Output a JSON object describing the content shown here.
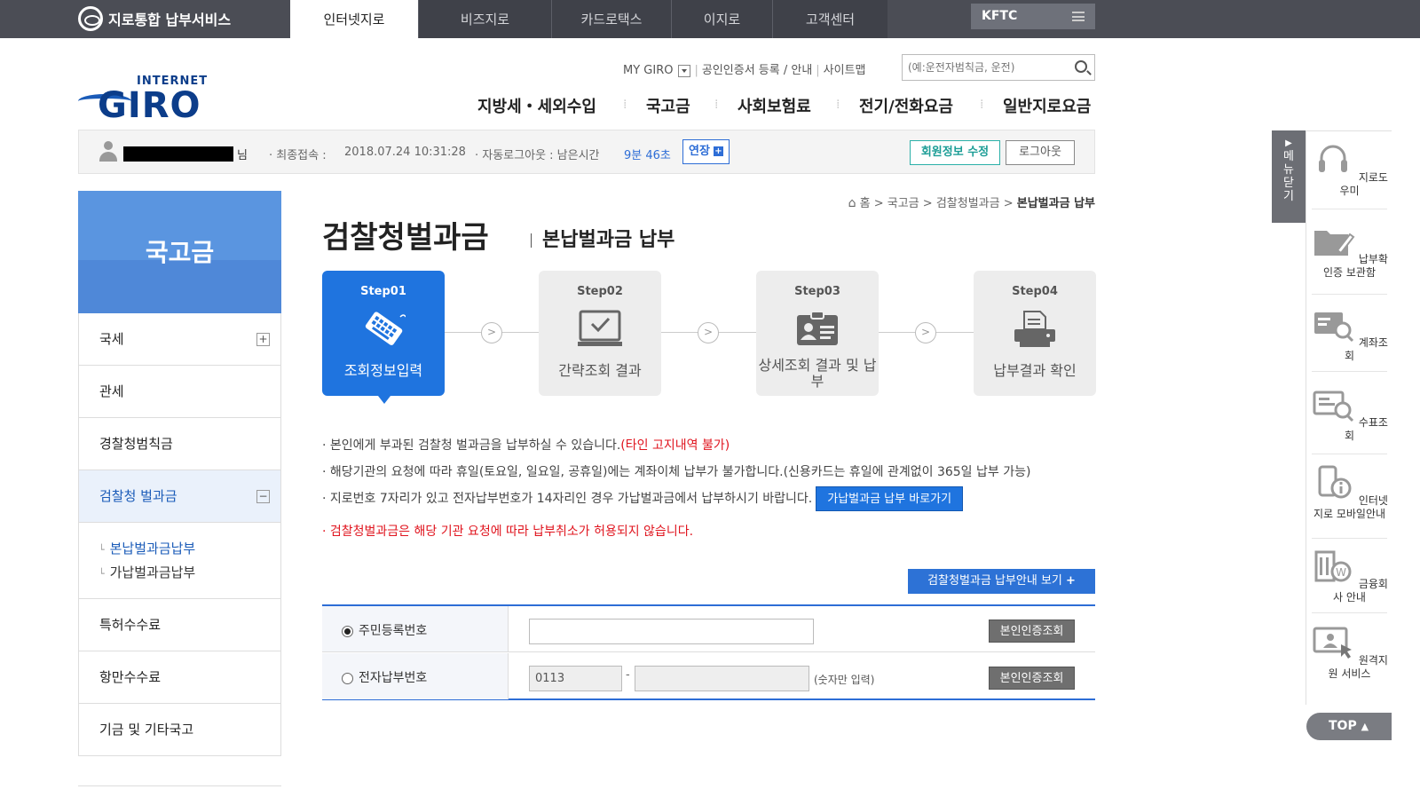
{
  "header": {
    "service_name": "지로통합 납부서비스",
    "tabs": [
      {
        "label": "인터넷지로",
        "active": true
      },
      {
        "label": "비즈지로"
      },
      {
        "label": "카드로택스"
      },
      {
        "label": "이지로"
      },
      {
        "label": "고객센터"
      }
    ],
    "kftc": "KFTC"
  },
  "logo": {
    "top": "INTERNET",
    "main": "GIRO"
  },
  "util": {
    "my_giro": "MY GIRO",
    "cert": "공인인증서 등록 / 안내",
    "sitemap": "사이트맵",
    "search_placeholder": "(예:운전자범칙금, 운전)"
  },
  "gnb": [
    "지방세・세외수입",
    "국고금",
    "사회보험료",
    "전기/전화요금",
    "일반지로요금"
  ],
  "userbar": {
    "suffix": "님",
    "last_login_label": "· 최종접속 :",
    "last_login": "2018.07.24 10:31:28",
    "auto_logout_label": "· 자동로그아웃 : 남은시간",
    "remaining": "9분 46초",
    "extend": "연장",
    "edit_member": "회원정보 수정",
    "logout": "로그아웃"
  },
  "lnb": {
    "title": "국고금",
    "items": [
      "국세",
      "관세",
      "경찰청범칙금",
      "검찰청 벌과금"
    ],
    "sub_items": [
      "본납벌과금납부",
      "가납벌과금납부"
    ],
    "items_after": [
      "특허수수료",
      "항만수수료",
      "기금 및 기타국고"
    ]
  },
  "breadcrumb": {
    "home": "홈",
    "b1": "국고금",
    "b2": "검찰청벌과금",
    "current": "본납벌과금 납부"
  },
  "page": {
    "title": "검찰청벌과금",
    "subtitle": "본납벌과금 납부"
  },
  "steps": [
    {
      "num": "Step01",
      "label": "조회정보입력",
      "active": true
    },
    {
      "num": "Step02",
      "label": "간략조회 결과"
    },
    {
      "num": "Step03",
      "label": "상세조회 결과 및 납부"
    },
    {
      "num": "Step04",
      "label": "납부결과 확인"
    }
  ],
  "notices": {
    "n1": "본인에게 부과된 검찰청 벌과금을 납부하실 수 있습니다.",
    "n1_red": "(타인 고지내역 불가)",
    "n2": "해당기관의 요청에 따라 휴일(토요일, 일요일, 공휴일)에는 계좌이체 납부가 불가합니다.(신용카드는 휴일에 관계없이 365일 납부 가능)",
    "n3": "지로번호 7자리가 있고 전자납부번호가 14자리인 경우 가납벌과금에서 납부하시기 바랍니다.",
    "n3_button": "가납벌과금 납부 바로가기",
    "n4": "검찰청벌과금은 해당 기관 요청에 따라 납부취소가 허용되지 않습니다."
  },
  "guide_button": "검찰청벌과금 납부안내 보기",
  "form": {
    "row1_label": "주민등록번호",
    "row2_label": "전자납부번호",
    "prefix_value": "0113",
    "dash": "-",
    "hint": "(숫자만 입력)",
    "auth_button": "본인인증조회"
  },
  "quick": {
    "close": "메뉴닫기",
    "items": [
      "지로도우미",
      "납부확인증 보관함",
      "계좌조회",
      "수표조회",
      "인터넷지로 모바일안내",
      "금융회사 안내",
      "원격지원 서비스"
    ],
    "top": "TOP"
  }
}
